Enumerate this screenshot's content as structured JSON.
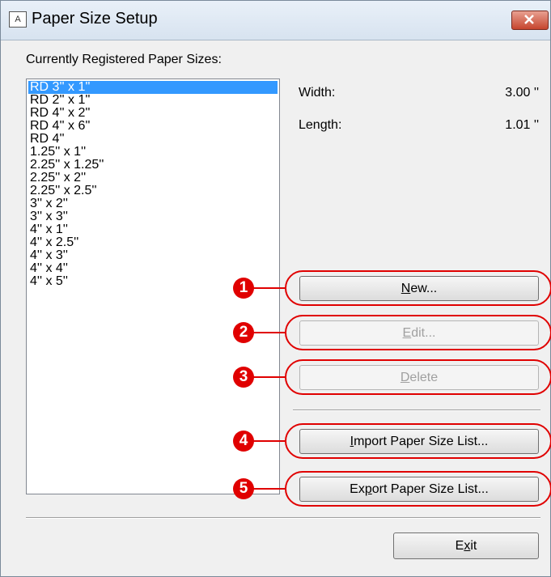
{
  "window": {
    "title": "Paper Size Setup",
    "icon": "label-app-icon"
  },
  "list": {
    "label": "Currently Registered Paper Sizes:",
    "items": [
      "RD 3'' x 1''",
      "RD 2'' x 1''",
      "RD 4'' x 2''",
      "RD 4'' x 6''",
      "RD 4''",
      "1.25'' x 1''",
      "2.25'' x 1.25''",
      "2.25'' x 2''",
      "2.25'' x 2.5''",
      "3'' x 2''",
      "3'' x 3''",
      "4'' x 1''",
      "4'' x 2.5''",
      "4'' x 3''",
      "4'' x 4''",
      "4'' x 5''"
    ],
    "selected_index": 0
  },
  "properties": {
    "width_label": "Width:",
    "width_value": "3.00 ''",
    "length_label": "Length:",
    "length_value": "1.01 ''"
  },
  "buttons": {
    "new": {
      "mnemonic": "N",
      "rest": "ew...",
      "enabled": true
    },
    "edit": {
      "mnemonic": "E",
      "rest": "dit...",
      "enabled": false
    },
    "delete": {
      "mnemonic": "D",
      "rest": "elete",
      "enabled": false
    },
    "import": {
      "mnemonic": "I",
      "rest": "mport Paper Size List...",
      "enabled": true
    },
    "export_pre": "Ex",
    "export_mnemonic": "p",
    "export_rest": "ort Paper Size List...",
    "exit_pre": "E",
    "exit_mnemonic": "x",
    "exit_rest": "it"
  },
  "callouts": [
    "1",
    "2",
    "3",
    "4",
    "5"
  ],
  "colors": {
    "callout": "#e00000",
    "selection": "#3399ff"
  }
}
